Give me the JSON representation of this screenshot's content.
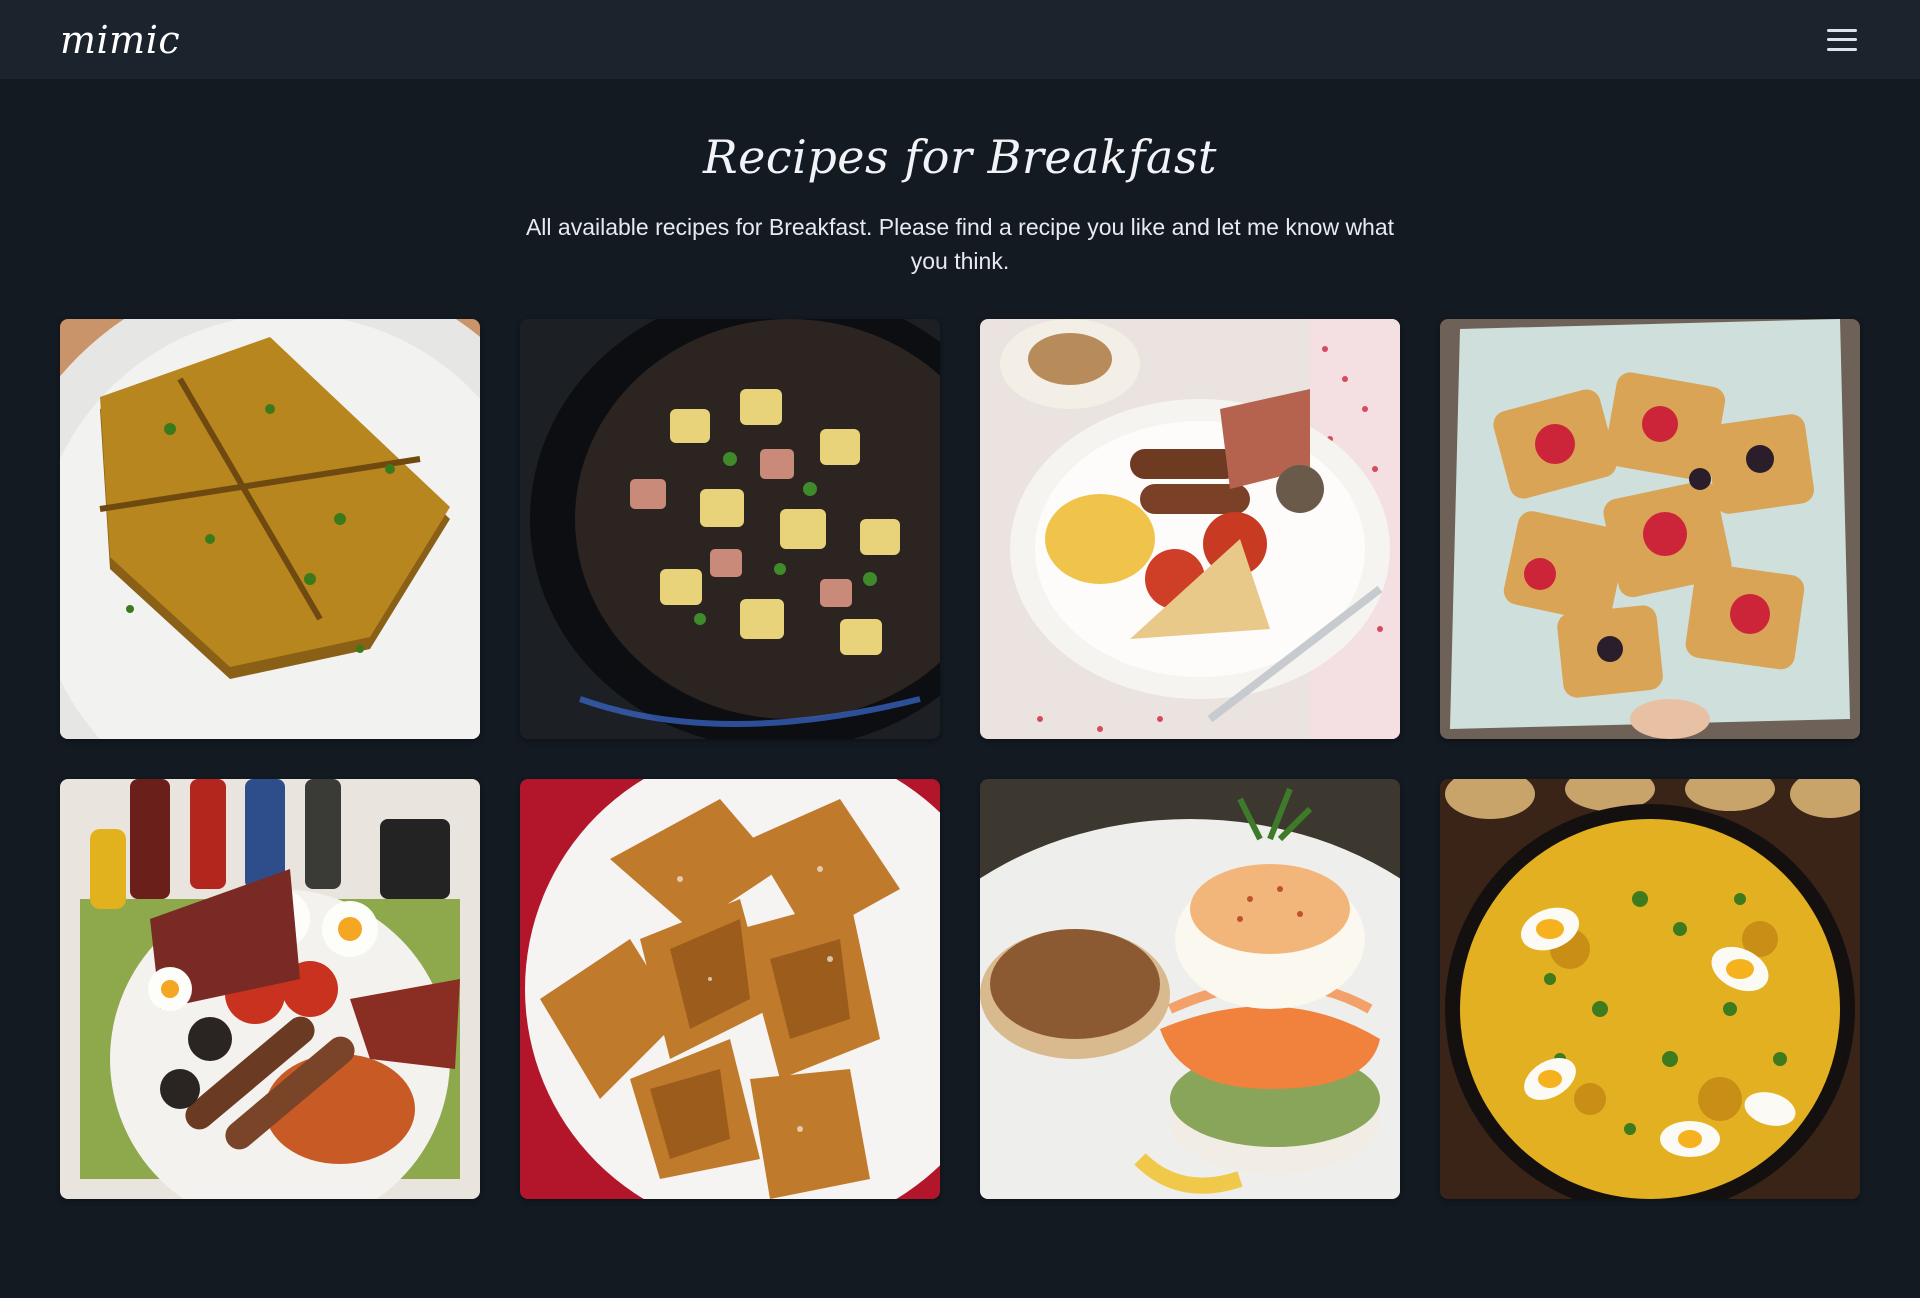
{
  "nav": {
    "logo": "mimic",
    "menu_icon": "hamburger-menu-icon"
  },
  "header": {
    "title": "Recipes for Breakfast",
    "subtitle": "All available recipes for Breakfast. Please find a recipe you like and let me know what you think."
  },
  "recipes": [
    {
      "image": "french-toast-squares"
    },
    {
      "image": "skillet-potato-hash"
    },
    {
      "image": "english-breakfast-plate-with-tea"
    },
    {
      "image": "berry-puff-pastries"
    },
    {
      "image": "full-english-breakfast-with-sauces"
    },
    {
      "image": "fried-dough-pastries"
    },
    {
      "image": "smoked-salmon-eggs-benedict"
    },
    {
      "image": "kedgeree-rice-pan"
    }
  ]
}
